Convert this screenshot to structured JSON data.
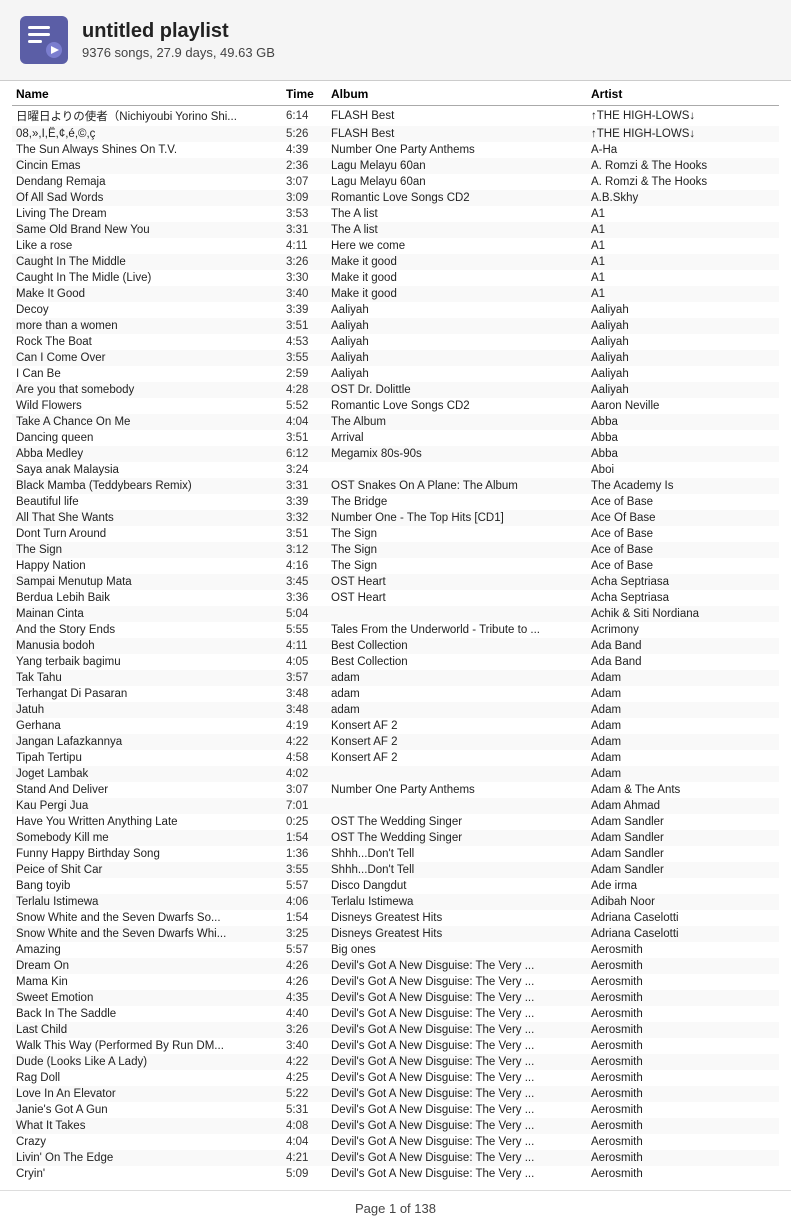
{
  "header": {
    "title": "untitled playlist",
    "subtitle": "9376 songs, 27.9 days, 49.63 GB"
  },
  "columns": {
    "name": "Name",
    "time": "Time",
    "album": "Album",
    "artist": "Artist"
  },
  "footer": "Page 1 of 138",
  "songs": [
    {
      "name": "日曜日よりの使者（Nichiyoubi Yorino Shi...",
      "time": "6:14",
      "album": "FLASH Best",
      "artist": "↑THE HIGH-LOWS↓"
    },
    {
      "name": "08,»,I,Ë,¢,é,©,ç",
      "time": "5:26",
      "album": "FLASH Best",
      "artist": "↑THE HIGH-LOWS↓"
    },
    {
      "name": "The Sun Always Shines On T.V.",
      "time": "4:39",
      "album": "Number One Party Anthems",
      "artist": "A-Ha"
    },
    {
      "name": "Cincin Emas",
      "time": "2:36",
      "album": "Lagu Melayu 60an",
      "artist": "A. Romzi & The Hooks"
    },
    {
      "name": "Dendang Remaja",
      "time": "3:07",
      "album": "Lagu Melayu 60an",
      "artist": "A. Romzi & The Hooks"
    },
    {
      "name": "Of All Sad Words",
      "time": "3:09",
      "album": "Romantic Love Songs CD2",
      "artist": "A.B.Skhy"
    },
    {
      "name": "Living The Dream",
      "time": "3:53",
      "album": "The A list",
      "artist": "A1"
    },
    {
      "name": "Same Old Brand New You",
      "time": "3:31",
      "album": "The A list",
      "artist": "A1"
    },
    {
      "name": "Like a rose",
      "time": "4:11",
      "album": "Here we come",
      "artist": "A1"
    },
    {
      "name": "Caught In The Middle",
      "time": "3:26",
      "album": "Make it good",
      "artist": "A1"
    },
    {
      "name": "Caught In The Midle (Live)",
      "time": "3:30",
      "album": "Make it good",
      "artist": "A1"
    },
    {
      "name": "Make It Good",
      "time": "3:40",
      "album": "Make it good",
      "artist": "A1"
    },
    {
      "name": "Decoy",
      "time": "3:39",
      "album": "Aaliyah",
      "artist": "Aaliyah"
    },
    {
      "name": "more than a women",
      "time": "3:51",
      "album": "Aaliyah",
      "artist": "Aaliyah"
    },
    {
      "name": "Rock The Boat",
      "time": "4:53",
      "album": "Aaliyah",
      "artist": "Aaliyah"
    },
    {
      "name": "Can I Come Over",
      "time": "3:55",
      "album": "Aaliyah",
      "artist": "Aaliyah"
    },
    {
      "name": "I Can Be",
      "time": "2:59",
      "album": "Aaliyah",
      "artist": "Aaliyah"
    },
    {
      "name": "Are you that somebody",
      "time": "4:28",
      "album": "OST Dr. Dolittle",
      "artist": "Aaliyah"
    },
    {
      "name": "Wild Flowers",
      "time": "5:52",
      "album": "Romantic Love Songs CD2",
      "artist": "Aaron Neville"
    },
    {
      "name": "Take A Chance On Me",
      "time": "4:04",
      "album": "The Album",
      "artist": "Abba"
    },
    {
      "name": "Dancing queen",
      "time": "3:51",
      "album": "Arrival",
      "artist": "Abba"
    },
    {
      "name": "Abba Medley",
      "time": "6:12",
      "album": "Megamix 80s-90s",
      "artist": "Abba"
    },
    {
      "name": "Saya anak Malaysia",
      "time": "3:24",
      "album": "",
      "artist": "Aboi"
    },
    {
      "name": "Black Mamba (Teddybears Remix)",
      "time": "3:31",
      "album": "OST Snakes On A Plane: The Album",
      "artist": "The Academy Is"
    },
    {
      "name": "Beautiful life",
      "time": "3:39",
      "album": "The Bridge",
      "artist": "Ace of Base"
    },
    {
      "name": "All That She Wants",
      "time": "3:32",
      "album": "Number One - The Top Hits [CD1]",
      "artist": "Ace Of Base"
    },
    {
      "name": "Dont Turn Around",
      "time": "3:51",
      "album": "The Sign",
      "artist": "Ace of Base"
    },
    {
      "name": "The Sign",
      "time": "3:12",
      "album": "The Sign",
      "artist": "Ace of Base"
    },
    {
      "name": "Happy Nation",
      "time": "4:16",
      "album": "The Sign",
      "artist": "Ace of Base"
    },
    {
      "name": "Sampai Menutup Mata",
      "time": "3:45",
      "album": "OST Heart",
      "artist": "Acha Septriasa"
    },
    {
      "name": "Berdua Lebih Baik",
      "time": "3:36",
      "album": "OST Heart",
      "artist": "Acha Septriasa"
    },
    {
      "name": "Mainan Cinta",
      "time": "5:04",
      "album": "",
      "artist": "Achik & Siti Nordiana"
    },
    {
      "name": "And the Story Ends",
      "time": "5:55",
      "album": "Tales From the Underworld - Tribute to ...",
      "artist": "Acrimony"
    },
    {
      "name": "Manusia bodoh",
      "time": "4:11",
      "album": "Best Collection",
      "artist": "Ada Band"
    },
    {
      "name": "Yang terbaik bagimu",
      "time": "4:05",
      "album": "Best Collection",
      "artist": "Ada Band"
    },
    {
      "name": "Tak Tahu",
      "time": "3:57",
      "album": "adam",
      "artist": "Adam"
    },
    {
      "name": "Terhangat Di Pasaran",
      "time": "3:48",
      "album": "adam",
      "artist": "Adam"
    },
    {
      "name": "Jatuh",
      "time": "3:48",
      "album": "adam",
      "artist": "Adam"
    },
    {
      "name": "Gerhana",
      "time": "4:19",
      "album": "Konsert AF 2",
      "artist": "Adam"
    },
    {
      "name": "Jangan Lafazkannya",
      "time": "4:22",
      "album": "Konsert AF 2",
      "artist": "Adam"
    },
    {
      "name": "Tipah Tertipu",
      "time": "4:58",
      "album": "Konsert AF 2",
      "artist": "Adam"
    },
    {
      "name": "Joget Lambak",
      "time": "4:02",
      "album": "",
      "artist": "Adam"
    },
    {
      "name": "Stand And Deliver",
      "time": "3:07",
      "album": "Number One Party Anthems",
      "artist": "Adam & The Ants"
    },
    {
      "name": "Kau Pergi Jua",
      "time": "7:01",
      "album": "",
      "artist": "Adam Ahmad"
    },
    {
      "name": "Have You Written Anything Late",
      "time": "0:25",
      "album": "OST The Wedding Singer",
      "artist": "Adam Sandler"
    },
    {
      "name": "Somebody Kill me",
      "time": "1:54",
      "album": "OST The Wedding Singer",
      "artist": "Adam Sandler"
    },
    {
      "name": "Funny Happy Birthday Song",
      "time": "1:36",
      "album": "Shhh...Don't Tell",
      "artist": "Adam Sandler"
    },
    {
      "name": "Peice of Shit Car",
      "time": "3:55",
      "album": "Shhh...Don't Tell",
      "artist": "Adam Sandler"
    },
    {
      "name": "Bang toyib",
      "time": "5:57",
      "album": "Disco Dangdut",
      "artist": "Ade irma"
    },
    {
      "name": "Terlalu Istimewa",
      "time": "4:06",
      "album": "Terlalu Istimewa",
      "artist": "Adibah Noor"
    },
    {
      "name": "Snow White and the Seven Dwarfs So...",
      "time": "1:54",
      "album": "Disneys Greatest Hits",
      "artist": "Adriana Caselotti"
    },
    {
      "name": "Snow White and the Seven Dwarfs Whi...",
      "time": "3:25",
      "album": "Disneys Greatest Hits",
      "artist": "Adriana Caselotti"
    },
    {
      "name": "Amazing",
      "time": "5:57",
      "album": "Big ones",
      "artist": "Aerosmith"
    },
    {
      "name": "Dream On",
      "time": "4:26",
      "album": "Devil's Got A New Disguise: The Very ...",
      "artist": "Aerosmith"
    },
    {
      "name": "Mama Kin",
      "time": "4:26",
      "album": "Devil's Got A New Disguise: The Very ...",
      "artist": "Aerosmith"
    },
    {
      "name": "Sweet Emotion",
      "time": "4:35",
      "album": "Devil's Got A New Disguise: The Very ...",
      "artist": "Aerosmith"
    },
    {
      "name": "Back In The Saddle",
      "time": "4:40",
      "album": "Devil's Got A New Disguise: The Very ...",
      "artist": "Aerosmith"
    },
    {
      "name": "Last Child",
      "time": "3:26",
      "album": "Devil's Got A New Disguise: The Very ...",
      "artist": "Aerosmith"
    },
    {
      "name": "Walk This Way (Performed By Run DM...",
      "time": "3:40",
      "album": "Devil's Got A New Disguise: The Very ...",
      "artist": "Aerosmith"
    },
    {
      "name": "Dude (Looks Like A Lady)",
      "time": "4:22",
      "album": "Devil's Got A New Disguise: The Very ...",
      "artist": "Aerosmith"
    },
    {
      "name": "Rag Doll",
      "time": "4:25",
      "album": "Devil's Got A New Disguise: The Very ...",
      "artist": "Aerosmith"
    },
    {
      "name": "Love In An Elevator",
      "time": "5:22",
      "album": "Devil's Got A New Disguise: The Very ...",
      "artist": "Aerosmith"
    },
    {
      "name": "Janie's Got A Gun",
      "time": "5:31",
      "album": "Devil's Got A New Disguise: The Very ...",
      "artist": "Aerosmith"
    },
    {
      "name": "What It Takes",
      "time": "4:08",
      "album": "Devil's Got A New Disguise: The Very ...",
      "artist": "Aerosmith"
    },
    {
      "name": "Crazy",
      "time": "4:04",
      "album": "Devil's Got A New Disguise: The Very ...",
      "artist": "Aerosmith"
    },
    {
      "name": "Livin' On The Edge",
      "time": "4:21",
      "album": "Devil's Got A New Disguise: The Very ...",
      "artist": "Aerosmith"
    },
    {
      "name": "Cryin'",
      "time": "5:09",
      "album": "Devil's Got A New Disguise: The Very ...",
      "artist": "Aerosmith"
    }
  ]
}
